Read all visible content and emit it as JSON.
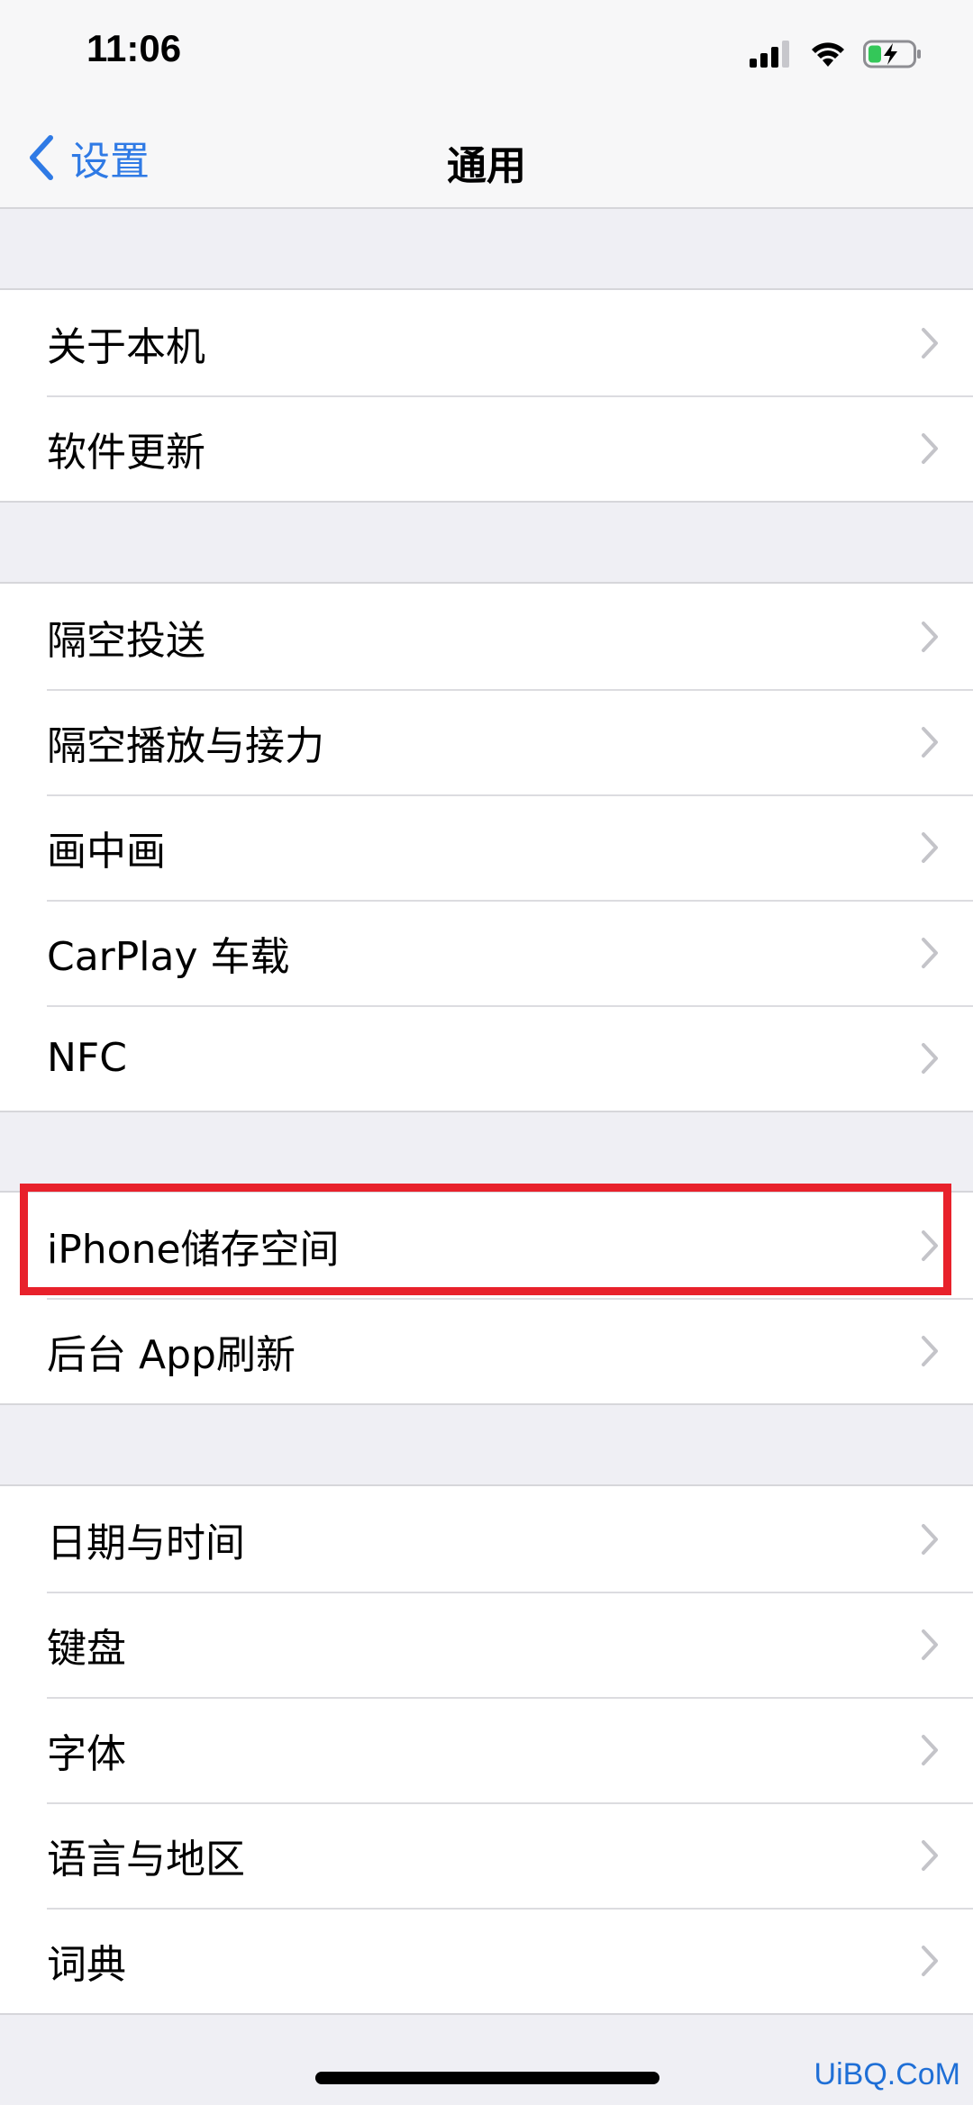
{
  "status_bar": {
    "time": "11:06",
    "icons": [
      "signal-icon",
      "wifi-icon",
      "battery-charging-icon"
    ]
  },
  "nav": {
    "back_label": "设置",
    "title": "通用"
  },
  "groups": [
    {
      "items": [
        "关于本机",
        "软件更新"
      ]
    },
    {
      "items": [
        "隔空投送",
        "隔空播放与接力",
        "画中画",
        "CarPlay 车载",
        "NFC"
      ]
    },
    {
      "items": [
        "iPhone储存空间",
        "后台 App刷新"
      ]
    },
    {
      "items": [
        "日期与时间",
        "键盘",
        "字体",
        "语言与地区",
        "词典"
      ]
    }
  ],
  "highlight": {
    "target": "iPhone储存空间",
    "color": "#e8212b"
  },
  "watermark": "UiBQ.CoM",
  "colors": {
    "accent": "#2f7ae5",
    "background": "#efeff4",
    "highlight": "#e8212b"
  }
}
